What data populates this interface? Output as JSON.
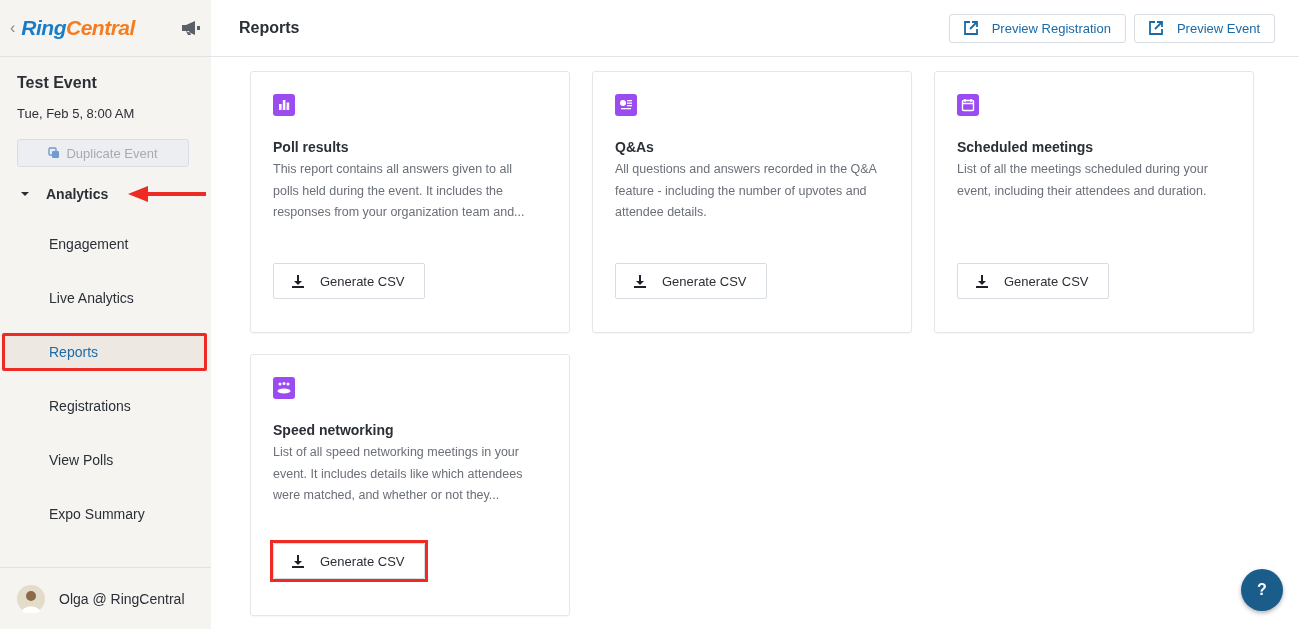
{
  "sidebar": {
    "back": "‹",
    "logo": [
      "Ring",
      "Central"
    ],
    "event_title": "Test Event",
    "event_date": "Tue, Feb 5, 8:00 AM",
    "duplicate_button": {
      "label": "Duplicate Event",
      "disabled": true
    },
    "section": {
      "label": "Analytics",
      "expanded": true,
      "annotated": true
    },
    "items": [
      {
        "label": "Engagement",
        "selected": false,
        "highlighted": false
      },
      {
        "label": "Live Analytics",
        "selected": false,
        "highlighted": false
      },
      {
        "label": "Reports",
        "selected": true,
        "highlighted": true
      },
      {
        "label": "Registrations",
        "selected": false,
        "highlighted": false
      },
      {
        "label": "View Polls",
        "selected": false,
        "highlighted": false
      },
      {
        "label": "Expo Summary",
        "selected": false,
        "highlighted": false
      }
    ],
    "user": "Olga @ RingCentral"
  },
  "header": {
    "title": "Reports",
    "buttons": [
      "Preview Registration",
      "Preview Event"
    ]
  },
  "cards": [
    {
      "kind": "poll",
      "title": "Poll results",
      "description": "This report contains all answers given to all polls held during the event. It includes the responses from your organization team and...",
      "button": "Generate CSV",
      "highlighted": false
    },
    {
      "kind": "qa",
      "title": "Q&As",
      "description": "All questions and answers recorded in the Q&A feature - including the number of upvotes and attendee details.",
      "button": "Generate CSV",
      "highlighted": false
    },
    {
      "kind": "meetings",
      "title": "Scheduled meetings",
      "description": "List of all the meetings scheduled during your event, including their attendees and duration.",
      "button": "Generate CSV",
      "highlighted": false
    },
    {
      "kind": "networking",
      "title": "Speed networking",
      "description": "List of all speed networking meetings in your event. It includes details like which attendees were matched, and whether or not they...",
      "button": "Generate CSV",
      "highlighted": true
    }
  ],
  "help": "?"
}
